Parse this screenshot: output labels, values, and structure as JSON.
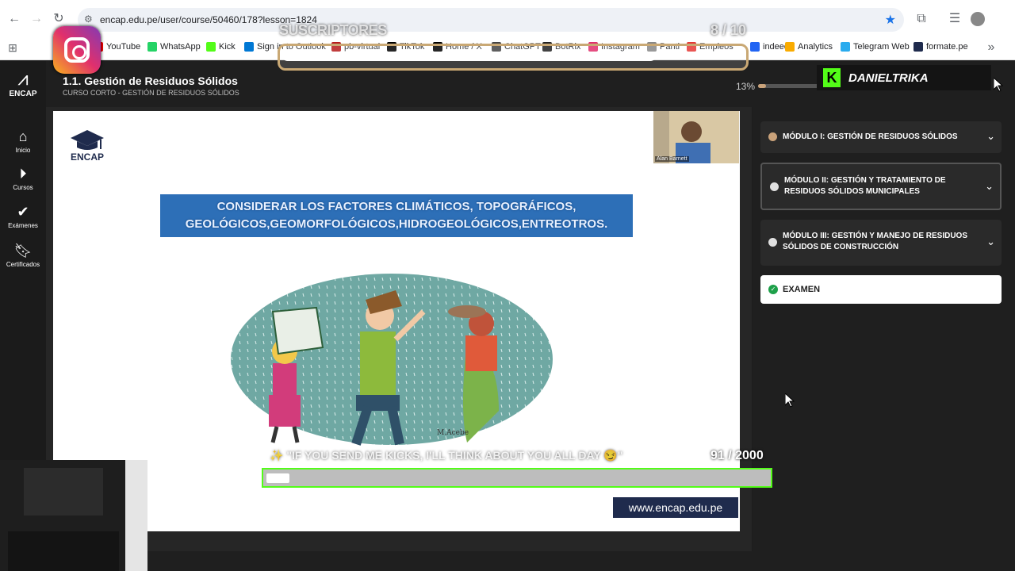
{
  "browser": {
    "url": "encap.edu.pe/user/course/50460/178?lesson=1824",
    "back_icon": "back-arrow-icon",
    "forward_icon": "forward-arrow-icon",
    "reload_icon": "reload-icon",
    "star_icon": "star-icon"
  },
  "bookmarks": [
    {
      "label": "YouTube",
      "color": "#ff0000"
    },
    {
      "label": "WhatsApp",
      "color": "#25d366"
    },
    {
      "label": "Kick",
      "color": "#53fc18"
    },
    {
      "label": "Sign in to Outlook",
      "color": "#0078d4"
    },
    {
      "label": "pb-virtual",
      "color": "#b71c1c"
    },
    {
      "label": "TikTok",
      "color": "#000000"
    },
    {
      "label": "Home / X",
      "color": "#000000"
    },
    {
      "label": "ChatGPT",
      "color": "#444444"
    },
    {
      "label": "BotRix",
      "color": "#222222"
    },
    {
      "label": "Instagram",
      "color": "#e1306c"
    },
    {
      "label": "Panti",
      "color": "#888888"
    },
    {
      "label": "Empleos",
      "color": "#e53935"
    },
    {
      "label": "indeed",
      "color": "#2164f3"
    },
    {
      "label": "Analytics",
      "color": "#f9ab00"
    },
    {
      "label": "Telegram Web",
      "color": "#2aabee"
    },
    {
      "label": "formate.pe",
      "color": "#1f2b4d"
    }
  ],
  "sidebar": {
    "brand": "ENCAP",
    "items": [
      {
        "label": "Inicio",
        "icon": "home-icon"
      },
      {
        "label": "Cursos",
        "icon": "play-circle-icon"
      },
      {
        "label": "Exámenes",
        "icon": "check-icon"
      },
      {
        "label": "Certificados",
        "icon": "bookmark-icon"
      }
    ]
  },
  "header": {
    "title": "1.1. Gestión de Residuos Sólidos",
    "subtitle": "CURSO CORTO - GESTIÓN DE RESIDUOS SÓLIDOS",
    "progress_label": "13%",
    "progress_value": 0.13
  },
  "slide": {
    "logo_text": "ENCAP",
    "banner_line1": "CONSIDERAR LOS FACTORES CLIMÁTICOS, TOPOGRÁFICOS,",
    "banner_line2": "GEOLÓGICOS,GEOMORFOLÓGICOS,HIDROGEOLÓGICOS,ENTREOTROS.",
    "webcam_name": "Alan Barnett",
    "footer_url": "www.encap.edu.pe",
    "illustration_signature": "M.Acebe"
  },
  "modules": [
    {
      "title": "MÓDULO I: GESTIÓN DE RESIDUOS SÓLIDOS",
      "status_color": "#c9a27a"
    },
    {
      "title": "MÓDULO II: GESTIÓN Y TRATAMIENTO DE RESIDUOS SÓLIDOS MUNICIPALES",
      "status_color": "#e0e0e0"
    },
    {
      "title": "MÓDULO III: GESTIÓN Y MANEJO DE RESIDUOS SÓLIDOS DE CONSTRUCCIÓN",
      "status_color": "#e0e0e0"
    }
  ],
  "exam": {
    "label": "EXAMEN",
    "status_color": "#1ea04a"
  },
  "overlays": {
    "subs_label": "SUSCRIPTORES",
    "subs_count": "8 / 10",
    "subs_progress": 0.8,
    "kick_name": "DANIELTRIKA",
    "kick_goal_text": "✨ \"IF YOU SEND ME KICKS, I'LL THINK ABOUT YOU ALL DAY 😏\"",
    "kick_goal_count": "91 / 2000",
    "kick_goal_progress": 0.045
  }
}
